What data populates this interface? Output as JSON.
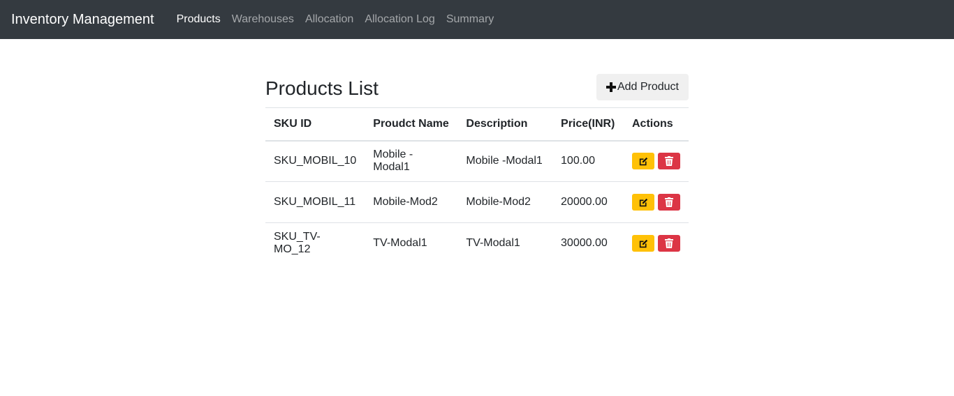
{
  "navbar": {
    "brand": "Inventory Management",
    "links": [
      {
        "label": "Products",
        "active": true
      },
      {
        "label": "Warehouses",
        "active": false
      },
      {
        "label": "Allocation",
        "active": false
      },
      {
        "label": "Allocation Log",
        "active": false
      },
      {
        "label": "Summary",
        "active": false
      }
    ]
  },
  "page": {
    "title": "Products List",
    "add_button_label": "Add Product"
  },
  "table": {
    "headers": [
      "SKU ID",
      "Proudct Name",
      "Description",
      "Price(INR)",
      "Actions"
    ],
    "rows": [
      {
        "sku": "SKU_MOBIL_10",
        "name": "Mobile -Modal1",
        "description": "Mobile -Modal1",
        "price": "100.00"
      },
      {
        "sku": "SKU_MOBIL_11",
        "name": "Mobile-Mod2",
        "description": "Mobile-Mod2",
        "price": "20000.00"
      },
      {
        "sku": "SKU_TV-MO_12",
        "name": "TV-Modal1",
        "description": "TV-Modal1",
        "price": "30000.00"
      }
    ]
  },
  "colors": {
    "navbar_bg": "#343a40",
    "edit_button": "#ffc107",
    "delete_button": "#dc3545"
  },
  "icons": {
    "add": "plus-icon",
    "edit": "edit-icon",
    "delete": "trash-icon"
  }
}
